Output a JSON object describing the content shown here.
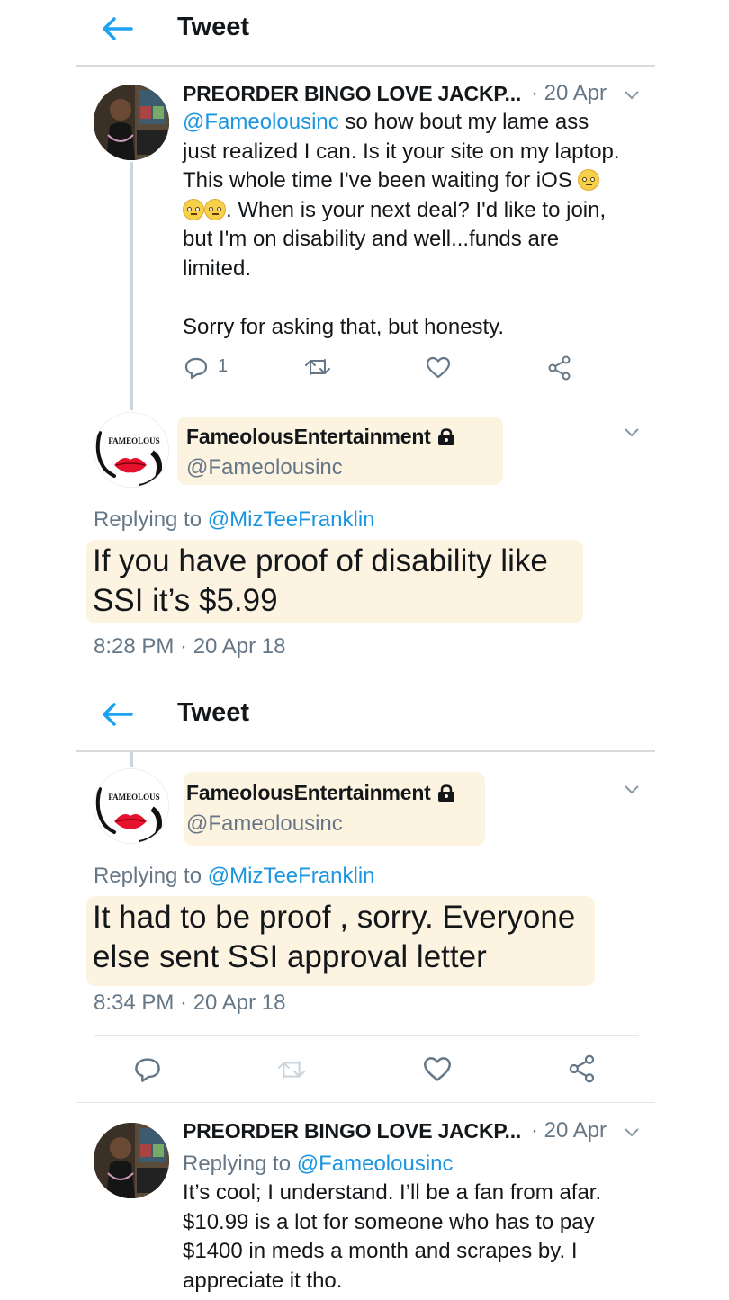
{
  "header1": {
    "title": "Tweet"
  },
  "header2": {
    "title": "Tweet"
  },
  "tweet1": {
    "name": "PREORDER BINGO LOVE JACKP...",
    "date": "· 20 Apr",
    "mention": "@Fameolousinc",
    "line1_rest": " so how bout my lame ass",
    "line2": "just realized I can. Is it your site on my laptop.",
    "line3": "This whole time I've been waiting for iOS",
    "line4_rest": ". When is your next deal? I'd like to join,",
    "line5": "but I'm on disability and well...funds are",
    "line6": "limited.",
    "line7": "Sorry for asking that, but honesty.",
    "reply_count": "1"
  },
  "tweet2": {
    "name": "FameolousEntertainment",
    "handle": "@Fameolousinc",
    "replying_prefix": "Replying to ",
    "replying_to": "@MizTeeFranklin",
    "text_line1": "If you have proof of disability like",
    "text_line2": "SSI it’s $5.99",
    "timestamp": "8:28 PM · 20 Apr 18",
    "avatar_brand": "FAMEOLOUS"
  },
  "tweet3": {
    "name": "FameolousEntertainment",
    "handle": "@Fameolousinc",
    "replying_prefix": "Replying to ",
    "replying_to": "@MizTeeFranklin",
    "text_line1": "It had to be proof , sorry. Everyone",
    "text_line2": "else sent SSI approval letter",
    "timestamp": "8:34 PM · 20 Apr 18",
    "avatar_brand": "FAMEOLOUS"
  },
  "tweet4": {
    "name": "PREORDER BINGO LOVE JACKP...",
    "date": "· 20 Apr",
    "replying_prefix": "Replying to ",
    "replying_to": "@Fameolousinc",
    "line1": "It’s cool; I understand. I’ll be a fan from afar.",
    "line2": "$10.99 is a lot for someone who has to pay",
    "line3": "$1400 in meds a month and scrapes by. I",
    "line4": "appreciate it tho."
  },
  "colors": {
    "link": "#1b95e0",
    "muted": "#657786",
    "highlight": "#fdf3e1",
    "lips": "#e8112d"
  }
}
